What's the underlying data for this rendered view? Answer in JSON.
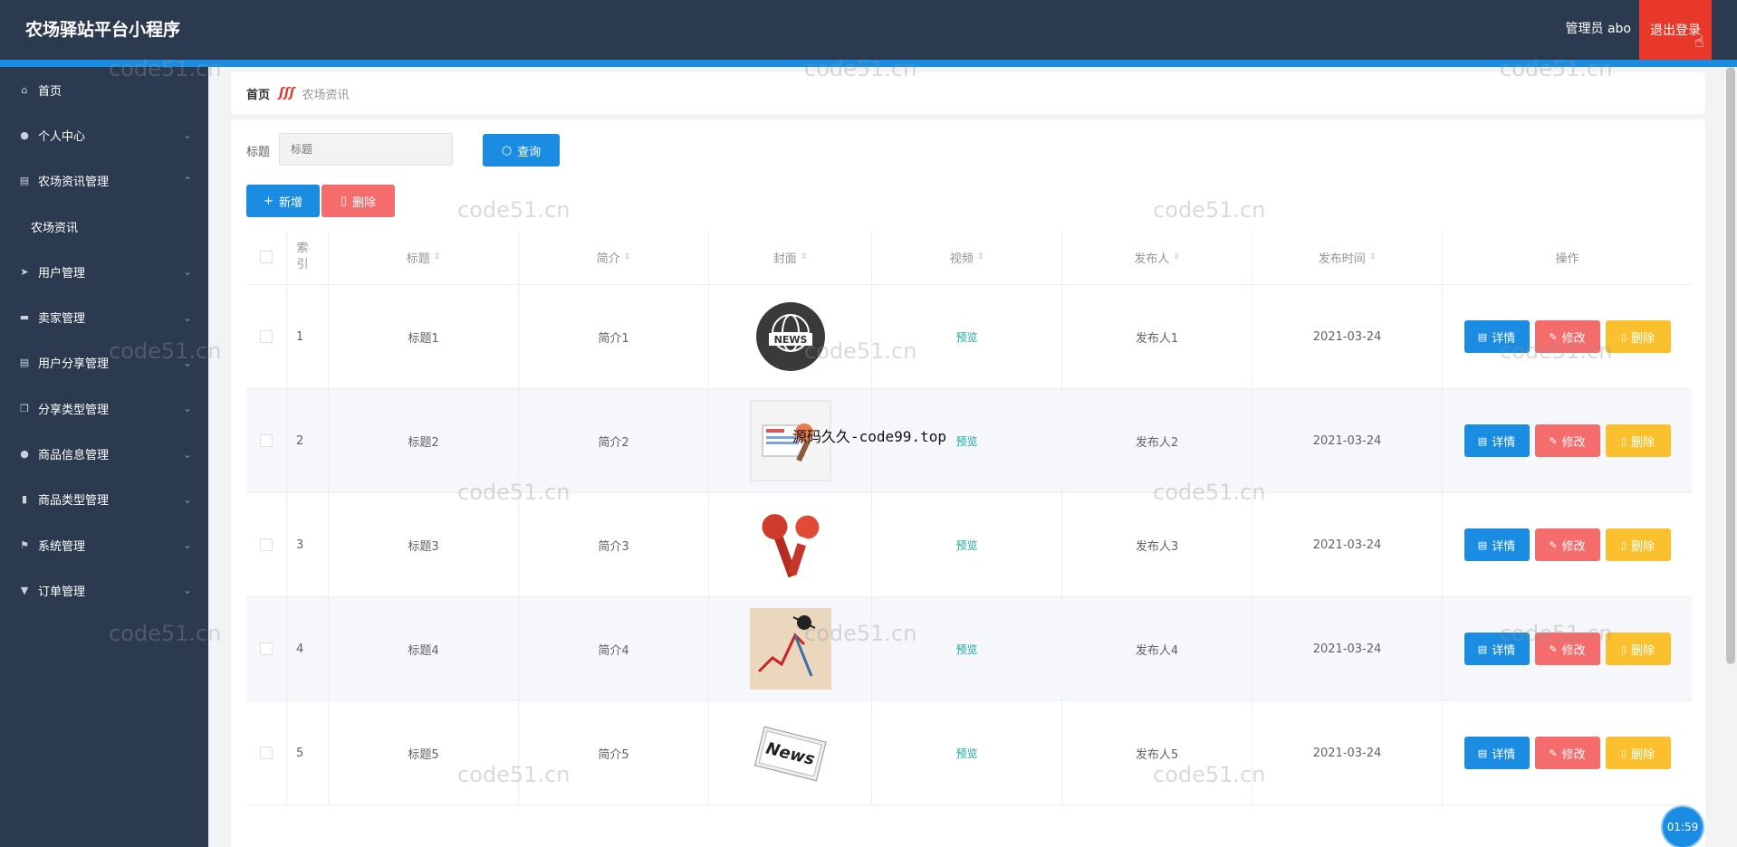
{
  "app": {
    "title": "农场驿站平台小程序",
    "user": "管理员 abo",
    "logout": "退出登录"
  },
  "sidebar": {
    "items": [
      {
        "label": "首页",
        "icon": "home-icon",
        "glyph": "⌂",
        "chevron": ""
      },
      {
        "label": "个人中心",
        "icon": "user-icon",
        "glyph": "●",
        "chevron": "⌄"
      },
      {
        "label": "农场资讯管理",
        "icon": "document-icon",
        "glyph": "▤",
        "chevron": "⌃"
      },
      {
        "label": "农场资讯",
        "icon": "",
        "glyph": "",
        "chevron": "",
        "sub": true
      },
      {
        "label": "用户管理",
        "icon": "send-icon",
        "glyph": "➤",
        "chevron": "⌄"
      },
      {
        "label": "卖家管理",
        "icon": "store-icon",
        "glyph": "▬",
        "chevron": "⌄"
      },
      {
        "label": "用户分享管理",
        "icon": "clipboard-icon",
        "glyph": "▤",
        "chevron": "⌄"
      },
      {
        "label": "分享类型管理",
        "icon": "copy-icon",
        "glyph": "❐",
        "chevron": "⌄"
      },
      {
        "label": "商品信息管理",
        "icon": "user-icon",
        "glyph": "●",
        "chevron": "⌄"
      },
      {
        "label": "商品类型管理",
        "icon": "microphone-icon",
        "glyph": "▮",
        "chevron": "⌄"
      },
      {
        "label": "系统管理",
        "icon": "flag-icon",
        "glyph": "⚑",
        "chevron": "⌄"
      },
      {
        "label": "订单管理",
        "icon": "goods-icon",
        "glyph": "▼",
        "chevron": "⌄"
      }
    ]
  },
  "breadcrumb": {
    "home": "首页",
    "separator": "ʃʃʃ",
    "current": "农场资讯"
  },
  "search": {
    "label": "标题",
    "placeholder": "标题",
    "query_label": "查询"
  },
  "actions": {
    "add_label": "新增",
    "delete_label": "删除"
  },
  "table": {
    "headers": {
      "index": "索引",
      "title": "标题",
      "intro": "简介",
      "cover": "封面",
      "video": "视频",
      "publisher": "发布人",
      "time": "发布时间",
      "ops": "操作"
    },
    "op_labels": {
      "detail": "详情",
      "edit": "修改",
      "remove": "删除"
    },
    "rows": [
      {
        "index": "1",
        "title": "标题1",
        "intro": "简介1",
        "cover": "news-globe-icon",
        "video": "预览",
        "publisher": "发布人1",
        "time": "2021-03-24"
      },
      {
        "index": "2",
        "title": "标题2",
        "intro": "简介2",
        "cover": "newspaper-icon",
        "video": "预览",
        "publisher": "发布人2",
        "time": "2021-03-24"
      },
      {
        "index": "3",
        "title": "标题3",
        "intro": "简介3",
        "cover": "microphones-icon",
        "video": "预览",
        "publisher": "发布人3",
        "time": "2021-03-24"
      },
      {
        "index": "4",
        "title": "标题4",
        "intro": "简介4",
        "cover": "chart-crash-icon",
        "video": "预览",
        "publisher": "发布人4",
        "time": "2021-03-24"
      },
      {
        "index": "5",
        "title": "标题5",
        "intro": "简介5",
        "cover": "news-paper-stack-icon",
        "video": "预览",
        "publisher": "发布人5",
        "time": "2021-03-24"
      }
    ]
  },
  "watermarks": {
    "site": "code51.cn",
    "overlay": "源码久久-code99.top"
  },
  "timer": "01:59",
  "colors": {
    "header": "#2c3a4f",
    "accent": "#1a8de3",
    "danger": "#f56c6c",
    "warning": "#fbc02d",
    "logout": "#e8382a",
    "link": "#13a89e"
  }
}
